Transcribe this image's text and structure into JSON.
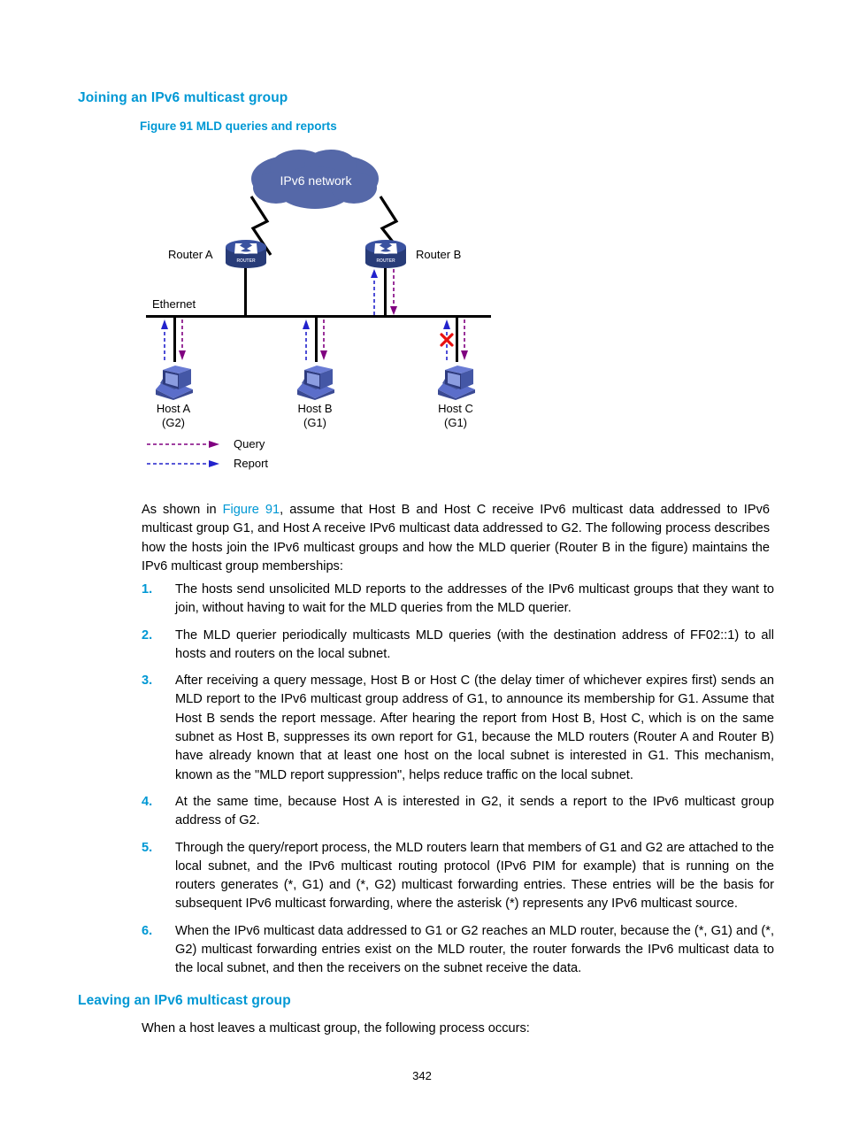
{
  "page": {
    "number": "342"
  },
  "headings": {
    "joining": "Joining an IPv6 multicast group",
    "leaving": "Leaving an IPv6 multicast group"
  },
  "figure": {
    "caption": "Figure 91 MLD queries and reports",
    "cloud_label": "IPv6 network",
    "ethernet_label": "Ethernet",
    "routers": [
      {
        "name": "Router A",
        "icon_text": "ROUTER"
      },
      {
        "name": "Router B",
        "icon_text": "ROUTER"
      }
    ],
    "hosts": [
      {
        "name": "Host A",
        "group": "(G2)"
      },
      {
        "name": "Host B",
        "group": "(G1)"
      },
      {
        "name": "Host C",
        "group": "(G1)"
      }
    ],
    "legend": [
      {
        "label": "Query",
        "color": "#800080"
      },
      {
        "label": "Report",
        "color": "#2222CC"
      }
    ],
    "colors": {
      "cloud": "#5568A8",
      "router": "#3A52A0",
      "host": "#4A5AA8",
      "query": "#800080",
      "report": "#2222CC",
      "suppression_x": "#E81010",
      "bus": "#000000"
    },
    "suppression_marker": "x"
  },
  "intro": {
    "before_ref": "As shown in ",
    "ref": "Figure 91",
    "after_ref": ", assume that Host B and Host C receive IPv6 multicast data addressed to IPv6 multicast group G1, and Host A receive IPv6 multicast data addressed to G2. The following process describes how the hosts join the IPv6 multicast groups and how the MLD querier (Router B in the figure) maintains the IPv6 multicast group memberships:"
  },
  "steps": [
    {
      "num": "1.",
      "text": "The hosts send unsolicited MLD reports to the addresses of the IPv6 multicast groups that they want to join, without having to wait for the MLD queries from the MLD querier."
    },
    {
      "num": "2.",
      "text": "The MLD querier periodically multicasts MLD queries (with the destination address of FF02::1) to all hosts and routers on the local subnet."
    },
    {
      "num": "3.",
      "text": "After receiving a query message, Host B or Host C (the delay timer of whichever expires first) sends an MLD report to the IPv6 multicast group address of G1, to announce its membership for G1. Assume that Host B sends the report message. After hearing the report from Host B, Host C, which is on the same subnet as Host B, suppresses its own report for G1, because the MLD routers (Router A and Router B) have already known that at least one host on the local subnet is interested in G1. This mechanism, known as the \"MLD report suppression\", helps reduce traffic on the local subnet."
    },
    {
      "num": "4.",
      "text": "At the same time, because Host A is interested in G2, it sends a report to the IPv6 multicast group address of G2."
    },
    {
      "num": "5.",
      "text": "Through the query/report process, the MLD routers learn that members of G1 and G2 are attached to the local subnet, and the IPv6 multicast routing protocol (IPv6 PIM for example) that is running on the routers generates (*, G1) and (*, G2) multicast forwarding entries. These entries will be the basis for subsequent IPv6 multicast forwarding, where the asterisk (*) represents any IPv6 multicast source."
    },
    {
      "num": "6.",
      "text": "When the IPv6 multicast data addressed to G1 or G2 reaches an MLD router, because the (*, G1) and (*, G2) multicast forwarding entries exist on the MLD router, the router forwards the IPv6 multicast data to the local subnet, and then the receivers on the subnet receive the data."
    }
  ],
  "leaving_intro": "When a host leaves a multicast group, the following process occurs:"
}
